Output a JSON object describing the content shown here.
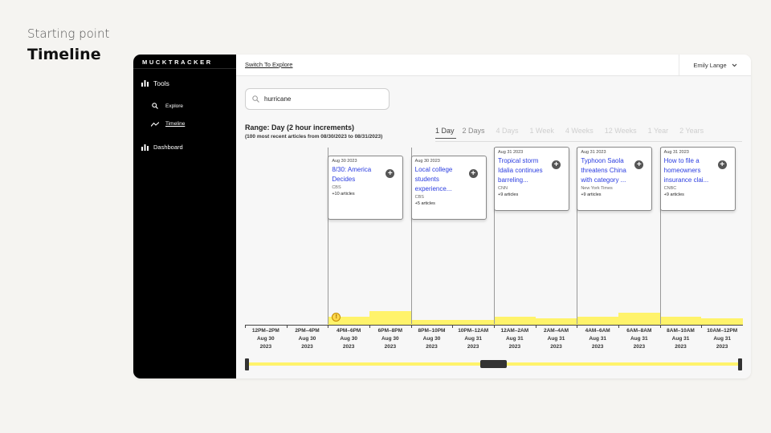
{
  "slide": {
    "subtitle": "Starting point",
    "title": "Timeline"
  },
  "app": {
    "brand": "MUCKTRACKER",
    "sidebar": {
      "tools": "Tools",
      "explore": "Explore",
      "timeline": "Timeline",
      "dashboard": "Dashboard"
    },
    "topbar": {
      "switch_link": "Switch To Explore",
      "user_name": "Emily Lange"
    },
    "search": {
      "value": "hurricane"
    },
    "range": {
      "title": "Range: Day (2 hour increments)",
      "subtitle": "(100 most recent articles from 08/30/2023 to 08/31/2023)",
      "tabs": [
        "1 Day",
        "2 Days",
        "4 Days",
        "1 Week",
        "4 Weeks",
        "12 Weeks",
        "1 Year",
        "2 Years"
      ],
      "active": "1 Day"
    },
    "cards": [
      {
        "date": "Aug 30 2023",
        "title": "8/30: America Decides",
        "source": "CBS",
        "count": "+10 articles"
      },
      {
        "date": "Aug 30 2023",
        "title": "Local college students experience...",
        "source": "CBS",
        "count": "+5 articles"
      },
      {
        "date": "Aug 31 2023",
        "title": "Tropical storm Idalia continues barreling...",
        "source": "CNN",
        "count": "+9 articles"
      },
      {
        "date": "Aug 31 2023",
        "title": "Typhoon Saola threatens China with category ...",
        "source": "New York Times",
        "count": "+9 articles"
      },
      {
        "date": "Aug 31 2023",
        "title": "How to file a homeowners insurance clai...",
        "source": "CNBC",
        "count": "+9 articles"
      }
    ],
    "buckets": [
      {
        "time": "12PM–2PM",
        "day": "Aug 30",
        "year": "2023",
        "level": 0
      },
      {
        "time": "2PM–4PM",
        "day": "Aug 30",
        "year": "2023",
        "level": 0
      },
      {
        "time": "4PM–6PM",
        "day": "Aug 30",
        "year": "2023",
        "level": 0.5
      },
      {
        "time": "6PM–8PM",
        "day": "Aug 30",
        "year": "2023",
        "level": 0.85
      },
      {
        "time": "8PM–10PM",
        "day": "Aug 30",
        "year": "2023",
        "level": 0.3
      },
      {
        "time": "10PM–12AM",
        "day": "Aug 31",
        "year": "2023",
        "level": 0.3
      },
      {
        "time": "12AM–2AM",
        "day": "Aug 31",
        "year": "2023",
        "level": 0.5
      },
      {
        "time": "2AM–4AM",
        "day": "Aug 31",
        "year": "2023",
        "level": 0.4
      },
      {
        "time": "4AM–6AM",
        "day": "Aug 31",
        "year": "2023",
        "level": 0.5
      },
      {
        "time": "6AM–8AM",
        "day": "Aug 31",
        "year": "2023",
        "level": 0.75
      },
      {
        "time": "8AM–10AM",
        "day": "Aug 31",
        "year": "2023",
        "level": 0.5
      },
      {
        "time": "10AM–12PM",
        "day": "Aug 31",
        "year": "2023",
        "level": 0.4
      }
    ],
    "scrollbar": {
      "thumb_position": 0.49
    },
    "colors": {
      "accent_yellow": "#fff36b",
      "link_blue": "#2b3de0",
      "sidebar": "#000000"
    }
  }
}
